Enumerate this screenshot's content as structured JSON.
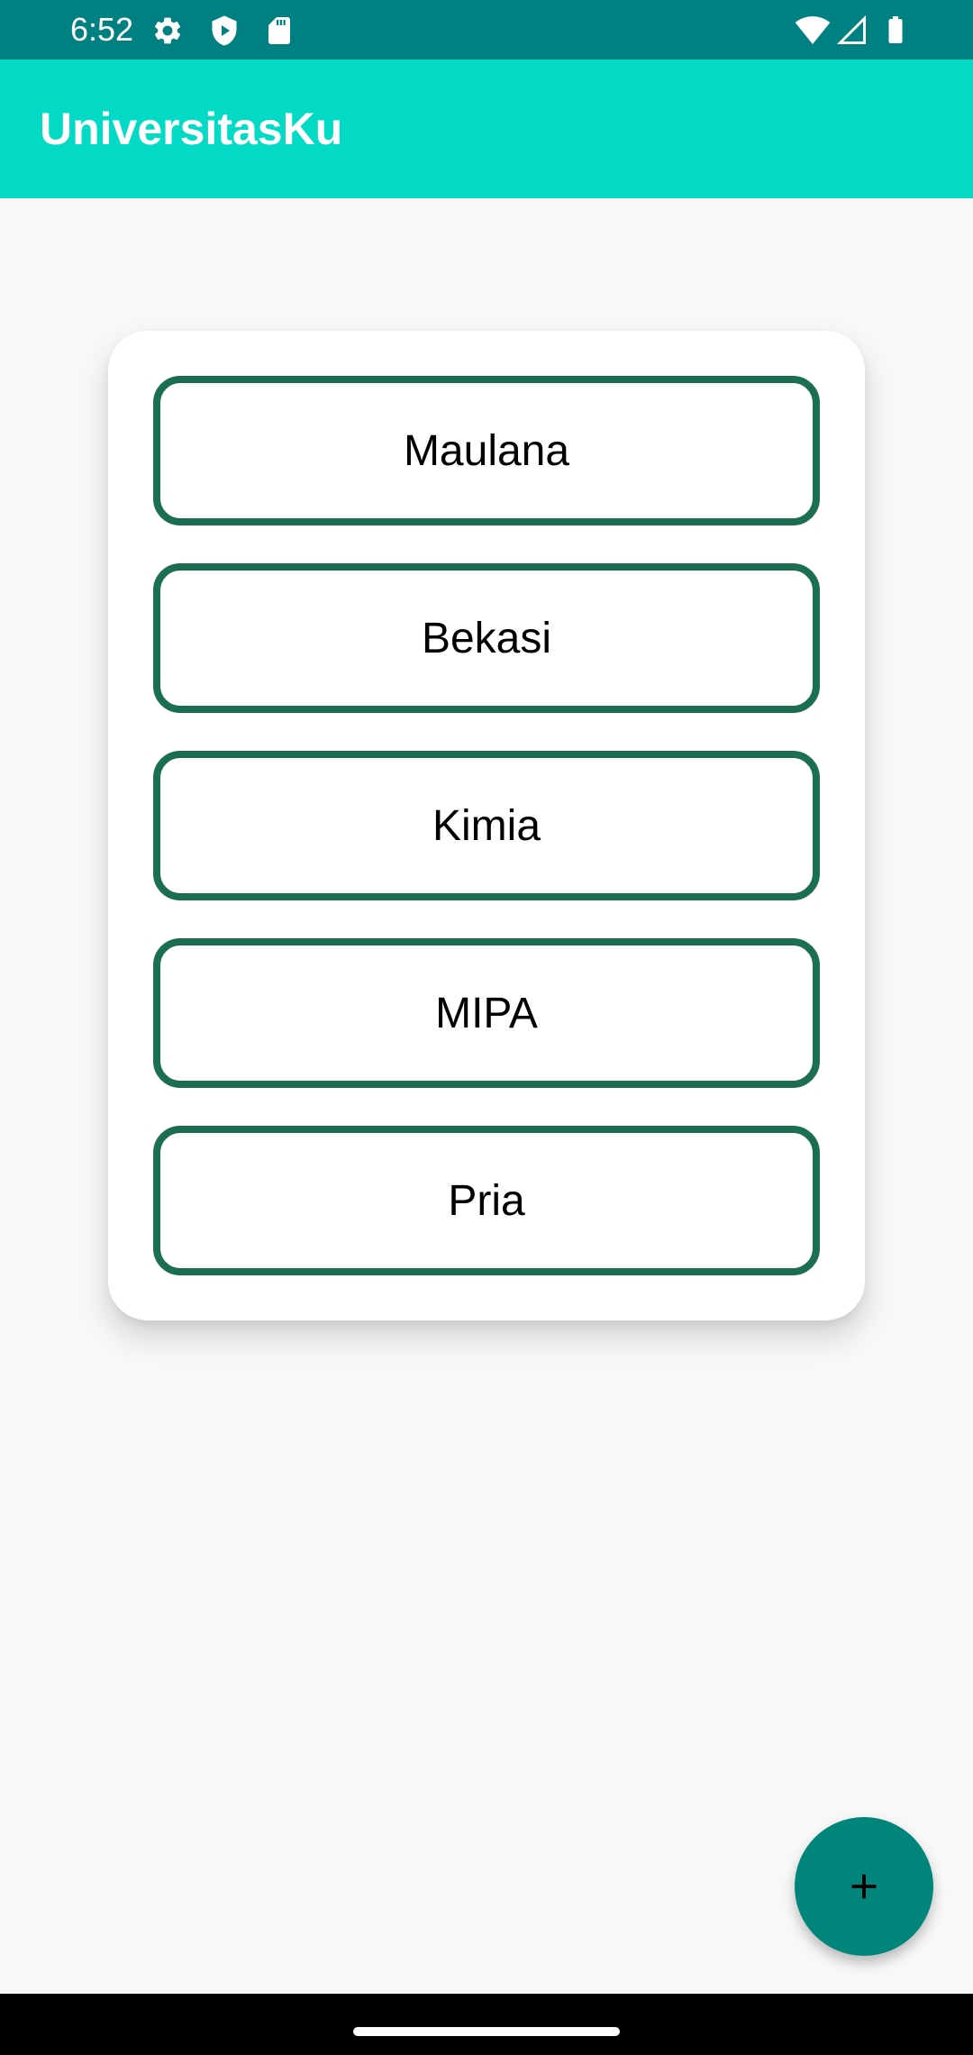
{
  "status_bar": {
    "time": "6:52",
    "left_icons": [
      "settings-icon",
      "play-protect-icon",
      "sd-card-icon"
    ],
    "right_icons": [
      "wifi-icon",
      "cellular-signal-icon",
      "battery-icon"
    ],
    "background_color": "#008080"
  },
  "app_bar": {
    "title": "UniversitasKu",
    "background_color": "#03dac5"
  },
  "card": {
    "fields": [
      {
        "value": "Maulana"
      },
      {
        "value": "Bekasi"
      },
      {
        "value": "Kimia"
      },
      {
        "value": "MIPA"
      },
      {
        "value": "Pria"
      }
    ],
    "border_color": "#1c6e50"
  },
  "fab": {
    "icon": "plus-icon",
    "background_color": "#00857b"
  },
  "nav_bar": {
    "handle": "home-gesture-handle"
  }
}
